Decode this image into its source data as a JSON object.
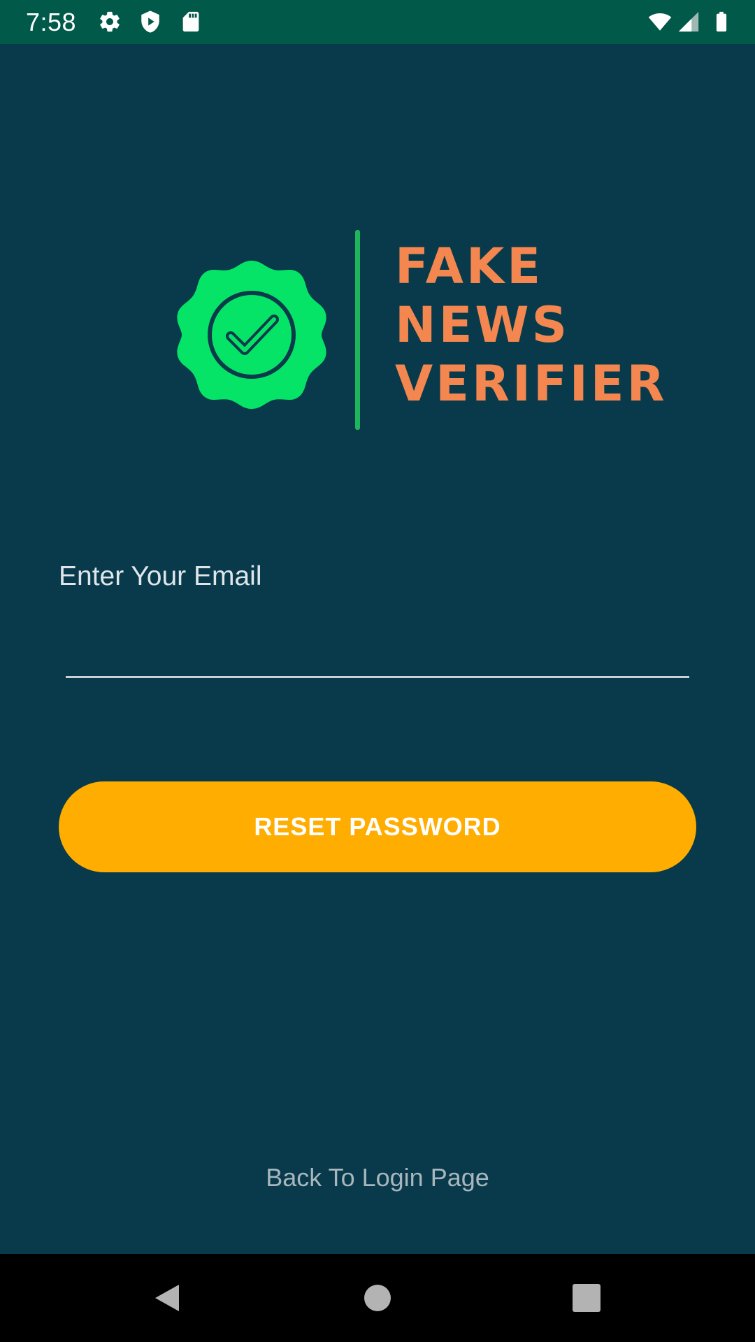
{
  "status_bar": {
    "time": "7:58",
    "left_icons": [
      "gear-icon",
      "shield-play-icon",
      "sd-card-icon"
    ],
    "right_icons": [
      "wifi-icon",
      "cellular-signal-icon",
      "battery-icon"
    ],
    "background_color": "#01594a"
  },
  "logo": {
    "line1": "FAKE",
    "line2": "NEWS",
    "line3": "VERIFIER",
    "seal_color": "#06e467",
    "text_color": "#f3874f",
    "icon": "check-badge-icon"
  },
  "form": {
    "email_label": "Enter Your Email",
    "email_value": "",
    "email_placeholder": "",
    "reset_button_label": "RESET PASSWORD",
    "reset_button_color": "#ffad00"
  },
  "footer": {
    "back_link_label": "Back To Login Page"
  },
  "nav_bar": {
    "buttons": [
      "back-icon",
      "home-icon",
      "recents-icon"
    ]
  },
  "colors": {
    "background": "#083a4b"
  }
}
